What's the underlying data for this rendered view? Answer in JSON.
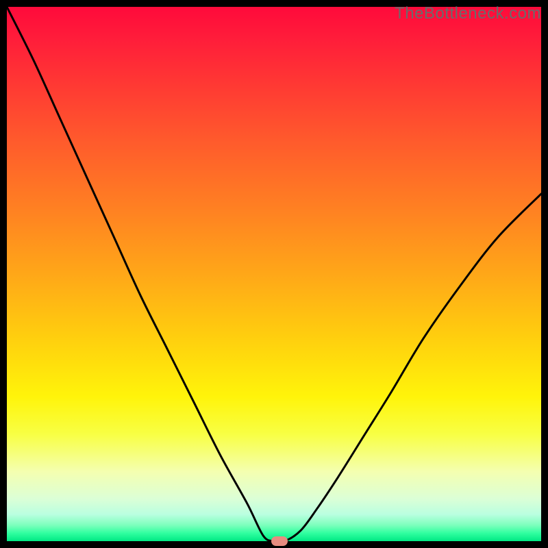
{
  "watermark": "TheBottleneck.com",
  "chart_data": {
    "type": "line",
    "title": "",
    "xlabel": "",
    "ylabel": "",
    "xlim": [
      0,
      100
    ],
    "ylim": [
      0,
      100
    ],
    "grid": false,
    "curve": {
      "x": [
        0,
        5,
        10,
        15,
        20,
        25,
        30,
        35,
        40,
        45,
        48,
        50,
        52,
        55,
        58,
        62,
        67,
        72,
        78,
        85,
        92,
        100
      ],
      "y": [
        100,
        90,
        79,
        68,
        57,
        46,
        36,
        26,
        16,
        7,
        1,
        0,
        0,
        2,
        6,
        12,
        20,
        28,
        38,
        48,
        57,
        65
      ]
    },
    "indicator": {
      "x": 51,
      "y": 0
    },
    "colors": {
      "curve": "#000000",
      "indicator": "#e78c80",
      "gradient_top": "#ff0a3b",
      "gradient_bottom": "#00e884",
      "background": "#000000"
    }
  }
}
